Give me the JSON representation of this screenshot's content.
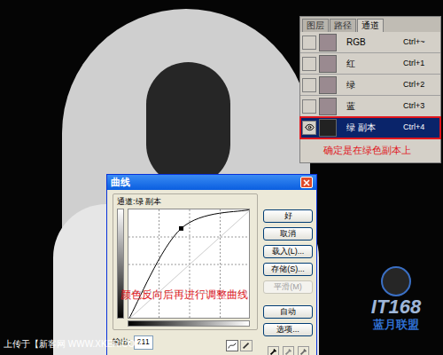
{
  "channels_panel": {
    "tabs": [
      {
        "label": "图层",
        "selected": false
      },
      {
        "label": "路径",
        "selected": false
      },
      {
        "label": "通道",
        "selected": true
      }
    ],
    "channels": [
      {
        "name": "RGB",
        "shortcut": "Ctrl+~",
        "visible": false,
        "selected": false
      },
      {
        "name": "红",
        "shortcut": "Ctrl+1",
        "visible": false,
        "selected": false
      },
      {
        "name": "绿",
        "shortcut": "Ctrl+2",
        "visible": false,
        "selected": false
      },
      {
        "name": "蓝",
        "shortcut": "Ctrl+3",
        "visible": false,
        "selected": false
      },
      {
        "name": "绿 副本",
        "shortcut": "Ctrl+4",
        "visible": true,
        "selected": true
      }
    ],
    "annotation": "确定是在绿色副本上"
  },
  "curves_dialog": {
    "title": "曲线",
    "channel_label": "通道:绿 副本",
    "buttons": [
      {
        "label": "好",
        "disabled": false
      },
      {
        "label": "取消",
        "disabled": false
      },
      {
        "label": "载入(L)...",
        "disabled": false
      },
      {
        "label": "存储(S)...",
        "disabled": false
      },
      {
        "label": "平滑(M)",
        "disabled": true
      },
      {
        "label": "自动",
        "disabled": false
      },
      {
        "label": "选项...",
        "disabled": false
      }
    ],
    "annotation": "颜色反向后再进行调整曲线",
    "curve": {
      "points": [
        [
          0,
          0
        ],
        [
          110,
          211
        ],
        [
          255,
          255
        ]
      ]
    },
    "output_label": "输出:",
    "output_value": "211"
  },
  "watermarks": {
    "source": "上传于【新客网 WWW.XKER.COM】",
    "logo": "IT168",
    "logo_sub": "蓝月联盟"
  }
}
